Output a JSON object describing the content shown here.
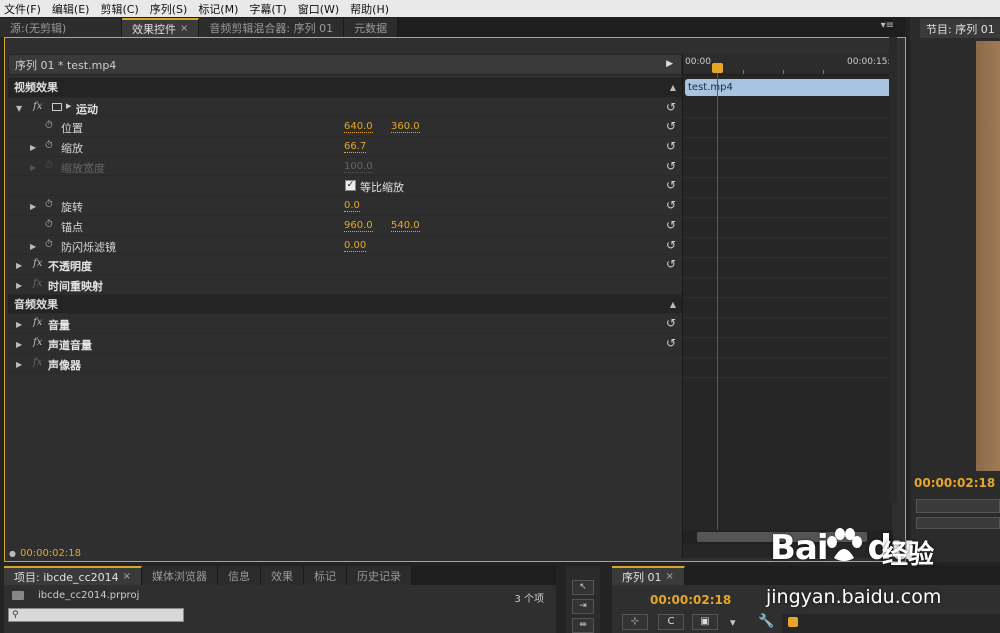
{
  "menu": [
    "文件(F)",
    "编辑(E)",
    "剪辑(C)",
    "序列(S)",
    "标记(M)",
    "字幕(T)",
    "窗口(W)",
    "帮助(H)"
  ],
  "top_tabs": [
    {
      "label": "源:(无剪辑)",
      "active": false
    },
    {
      "label": "效果控件",
      "active": true
    },
    {
      "label": "音频剪辑混合器: 序列 01",
      "active": false
    },
    {
      "label": "元数据",
      "active": false
    }
  ],
  "effect_controls": {
    "clip_header": "序列 01 * test.mp4",
    "video_section": "视频效果",
    "audio_section": "音频效果",
    "motion": "运动",
    "position_label": "位置",
    "position_x": "640.0",
    "position_y": "360.0",
    "scale_label": "缩放",
    "scale_value": "66.7",
    "scale_width_label": "缩放宽度",
    "scale_width_value": "100.0",
    "uniform_scale_label": "等比缩放",
    "rotation_label": "旋转",
    "rotation_value": "0.0",
    "anchor_label": "锚点",
    "anchor_x": "960.0",
    "anchor_y": "540.0",
    "antiflicker_label": "防闪烁滤镜",
    "antiflicker_value": "0.00",
    "opacity": "不透明度",
    "time_remap": "时间重映射",
    "volume": "音量",
    "channel_volume": "声道音量",
    "panner": "声像器",
    "fx_glyph": "fx",
    "status_timecode": "00:00:02:18"
  },
  "ec_timeline": {
    "start": "00:00",
    "end": "00:00:15:",
    "clip_name": "test.mp4"
  },
  "program_monitor": {
    "tab_label": "节目: 序列 01",
    "timecode": "00:00:02:18"
  },
  "project_panel": {
    "tabs": [
      "项目: ibcde_cc2014",
      "媒体浏览器",
      "信息",
      "效果",
      "标记",
      "历史记录"
    ],
    "file_name": "ibcde_cc2014.prproj",
    "item_count": "3 个项"
  },
  "sequence_panel": {
    "tab_label": "序列 01",
    "timecode": "00:00:02:18"
  },
  "watermark": {
    "logo": "Bai",
    "logo_tail": "du",
    "jingyan": "经验",
    "url": "jingyan.baidu.com"
  },
  "colors": {
    "accent": "#e5a62a",
    "playhead": "#e02020",
    "clip": "#a9c4e0"
  }
}
